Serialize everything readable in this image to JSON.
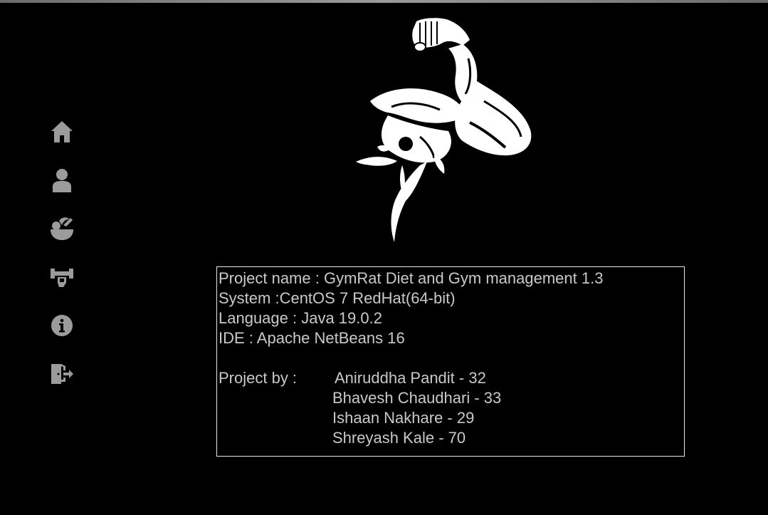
{
  "window": {
    "title": ""
  },
  "sidebar": {
    "items": [
      {
        "icon": "home-icon",
        "label": "Home"
      },
      {
        "icon": "user-icon",
        "label": "Profile"
      },
      {
        "icon": "diet-bowl-icon",
        "label": "Diet"
      },
      {
        "icon": "gym-icon",
        "label": "Gym"
      },
      {
        "icon": "info-icon",
        "label": "About"
      },
      {
        "icon": "logout-icon",
        "label": "Logout"
      }
    ],
    "icon_color": "#9b9b9b"
  },
  "logo": {
    "icon": "flexed-arm-logo"
  },
  "about": {
    "project_name": "Project name : GymRat Diet and Gym management 1.3",
    "system": "System :CentOS 7 RedHat(64-bit)",
    "language": "Language : Java 19.0.2",
    "ide": "IDE : Apache NetBeans 16",
    "project_by_label": "Project by :",
    "members": [
      "Aniruddha Pandit - 32",
      "Bhavesh Chaudhari - 33",
      "Ishaan Nakhare - 29",
      "Shreyash Kale - 70"
    ]
  },
  "colors": {
    "background": "#000000",
    "text": "#c9c9c9",
    "border": "#e6e6e6"
  }
}
